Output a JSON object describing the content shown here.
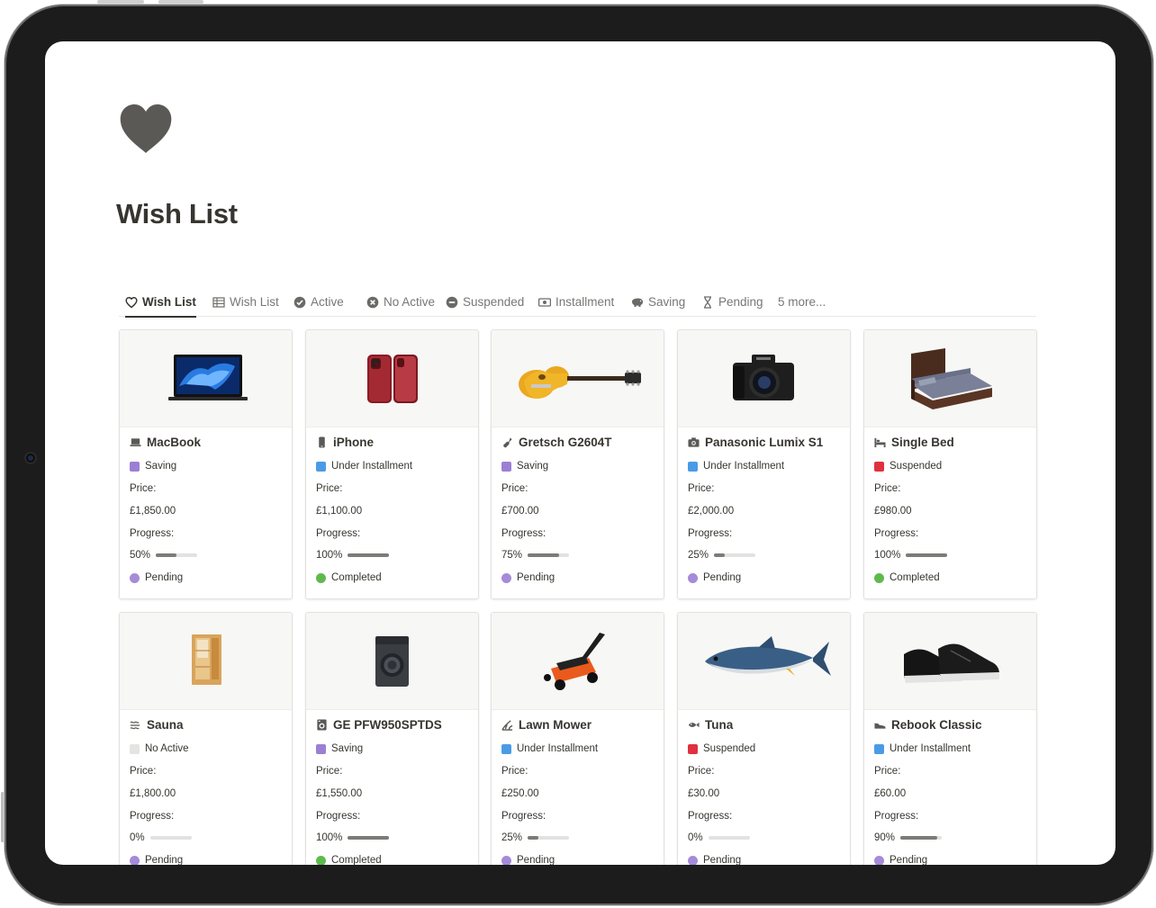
{
  "page": {
    "title": "Wish List",
    "icon": "heart-icon"
  },
  "tabs": [
    {
      "label": "Wish List",
      "icon": "heart-outline-icon",
      "active": true
    },
    {
      "label": "Wish List",
      "icon": "table-icon"
    },
    {
      "label": "Active",
      "icon": "check-circle-icon"
    },
    {
      "label": "No Active",
      "icon": "x-circle-icon"
    },
    {
      "label": "Suspended",
      "icon": "minus-circle-icon"
    },
    {
      "label": "Installment",
      "icon": "cash-icon"
    },
    {
      "label": "Saving",
      "icon": "piggy-bank-icon"
    },
    {
      "label": "Pending",
      "icon": "hourglass-icon"
    },
    {
      "label": "5 more..."
    }
  ],
  "labels": {
    "price": "Price:",
    "progress": "Progress:"
  },
  "colors": {
    "Saving": "#9b7fd4",
    "Under Installment": "#4a9be6",
    "Suspended": "#e0313f",
    "No Active": "#e4e4e2",
    "Pending": "#a58bd8",
    "Completed": "#5fba4e"
  },
  "cards": [
    {
      "name": "MacBook",
      "icon": "laptop-icon",
      "image": "macbook-image",
      "status": "Saving",
      "price": "£1,850.00",
      "progress_text": "50%",
      "progress": 0.5,
      "stage": "Pending"
    },
    {
      "name": "iPhone",
      "icon": "phone-icon",
      "image": "iphone-image",
      "status": "Under Installment",
      "price": "£1,100.00",
      "progress_text": "100%",
      "progress": 1.0,
      "stage": "Completed"
    },
    {
      "name": "Gretsch G2604T",
      "icon": "guitar-icon",
      "image": "guitar-image",
      "status": "Saving",
      "price": "£700.00",
      "progress_text": "75%",
      "progress": 0.75,
      "stage": "Pending"
    },
    {
      "name": "Panasonic Lumix S1",
      "icon": "camera-icon",
      "image": "camera-image",
      "status": "Under Installment",
      "price": "£2,000.00",
      "progress_text": "25%",
      "progress": 0.25,
      "stage": "Pending"
    },
    {
      "name": "Single Bed",
      "icon": "bed-icon",
      "image": "bed-image",
      "status": "Suspended",
      "price": "£980.00",
      "progress_text": "100%",
      "progress": 1.0,
      "stage": "Completed"
    },
    {
      "name": "Sauna",
      "icon": "steam-icon",
      "image": "sauna-image",
      "status": "No Active",
      "price": "£1,800.00",
      "progress_text": "0%",
      "progress": 0,
      "stage": "Pending"
    },
    {
      "name": "GE PFW950SPTDS",
      "icon": "washer-icon",
      "image": "washer-image",
      "status": "Saving",
      "price": "£1,550.00",
      "progress_text": "100%",
      "progress": 1.0,
      "stage": "Completed"
    },
    {
      "name": "Lawn Mower",
      "icon": "grass-icon",
      "image": "mower-image",
      "status": "Under Installment",
      "price": "£250.00",
      "progress_text": "25%",
      "progress": 0.25,
      "stage": "Pending"
    },
    {
      "name": "Tuna",
      "icon": "fish-icon",
      "image": "tuna-image",
      "status": "Suspended",
      "price": "£30.00",
      "progress_text": "0%",
      "progress": 0,
      "stage": "Pending"
    },
    {
      "name": "Rebook Classic",
      "icon": "shoe-icon",
      "image": "shoe-image",
      "status": "Under Installment",
      "price": "£60.00",
      "progress_text": "90%",
      "progress": 0.9,
      "stage": "Pending"
    }
  ]
}
